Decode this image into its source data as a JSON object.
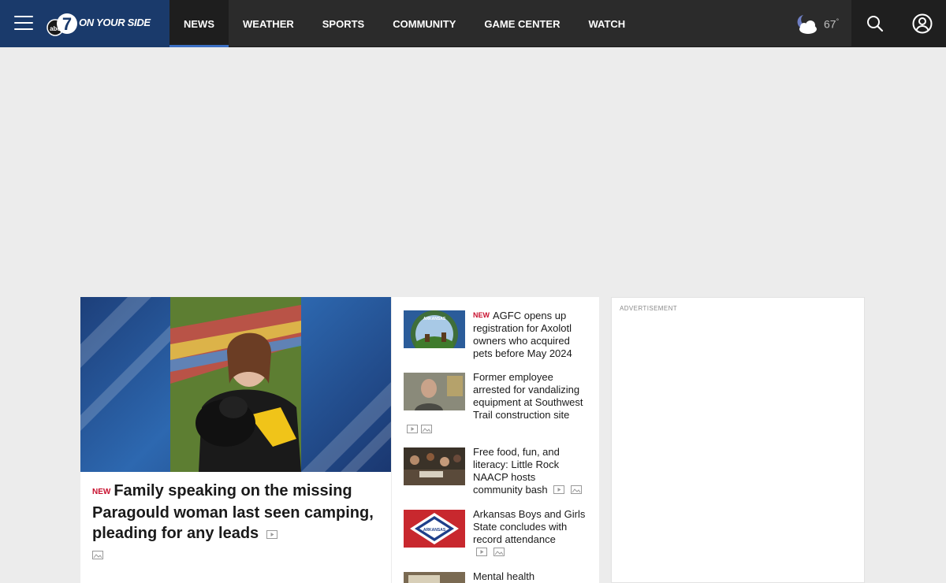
{
  "header": {
    "logo_text": "ON YOUR SIDE",
    "logo_badge": "abc",
    "logo_number": "7",
    "nav": [
      {
        "label": "NEWS",
        "active": true
      },
      {
        "label": "WEATHER"
      },
      {
        "label": "SPORTS"
      },
      {
        "label": "COMMUNITY"
      },
      {
        "label": "GAME CENTER"
      },
      {
        "label": "WATCH"
      }
    ],
    "weather": {
      "temp": "67",
      "unit": "°",
      "icon": "partly-cloudy-night-icon"
    },
    "icons": {
      "menu": "hamburger-menu-icon",
      "search": "search-icon",
      "account": "user-account-icon"
    }
  },
  "lead": {
    "tag": "NEW",
    "title": "Family speaking on the missing Paragould woman last seen camping, pleading for any leads"
  },
  "stories": [
    {
      "tag": "NEW",
      "title": "AGFC opens up registration for Axolotl owners who acquired pets before May 2024",
      "thumb": "arkansas-seal"
    },
    {
      "title": "Former employee arrested for vandalizing equipment at Southwest Trail construction site",
      "thumb": "man-portrait"
    },
    {
      "title": "Free food, fun, and literacy: Little Rock NAACP hosts community bash",
      "thumb": "crowd"
    },
    {
      "title": "Arkansas Boys and Girls State concludes with record attendance",
      "thumb": "arkansas-flag"
    },
    {
      "title": "Mental health",
      "thumb": "room"
    }
  ],
  "ad": {
    "label": "ADVERTISEMENT"
  },
  "colors": {
    "brand_blue": "#1a3a6b",
    "nav_bg": "#2b2b2b",
    "accent": "#3b6fc4",
    "new_tag": "#c8102e"
  }
}
